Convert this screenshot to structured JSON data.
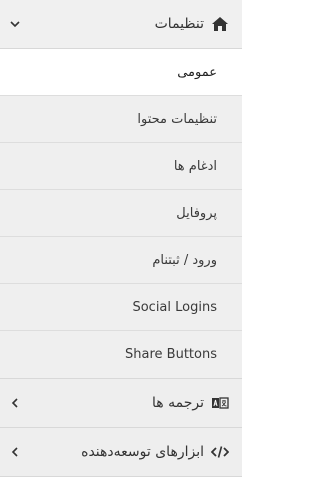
{
  "menu": {
    "settings": {
      "label": "تنظیمات",
      "icon": "home-icon",
      "state": "expanded",
      "items": [
        {
          "label": "عمومی",
          "active": true
        },
        {
          "label": "تنظیمات محتوا",
          "active": false
        },
        {
          "label": "ادغام ها",
          "active": false
        },
        {
          "label": "پروفایل",
          "active": false
        },
        {
          "label": "ورود / ثبتنام",
          "active": false
        },
        {
          "label": "Social Logins",
          "active": false
        },
        {
          "label": "Share Buttons",
          "active": false
        }
      ]
    },
    "translations": {
      "label": "ترجمه ها",
      "icon": "language-icon",
      "state": "collapsed"
    },
    "developer_tools": {
      "label": "ابزارهای توسعه‌دهنده",
      "icon": "code-icon",
      "state": "collapsed"
    }
  },
  "colors": {
    "header_bg": "#f0f0f0",
    "item_bg": "#efefef",
    "active_bg": "#ffffff",
    "border": "#d8d8d8"
  }
}
